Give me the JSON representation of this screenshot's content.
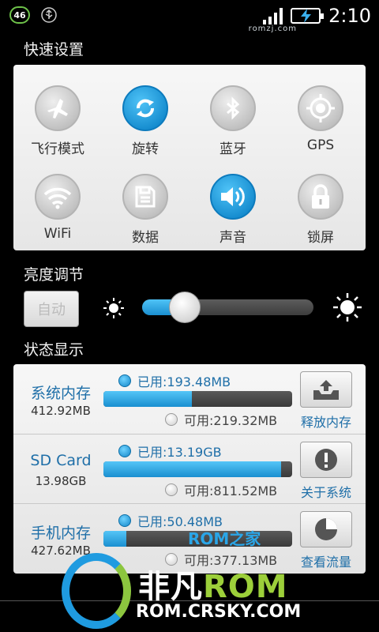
{
  "status_bar": {
    "network_badge": "46",
    "usb_icon": "usb-icon",
    "time": "2:10",
    "watermark": "romzj.com"
  },
  "quick_settings": {
    "title": "快速设置",
    "tiles": [
      {
        "label": "飞行模式",
        "icon": "airplane-icon",
        "active": false
      },
      {
        "label": "旋转",
        "icon": "rotate-icon",
        "active": true
      },
      {
        "label": "蓝牙",
        "icon": "bluetooth-icon",
        "active": false
      },
      {
        "label": "GPS",
        "icon": "gps-icon",
        "active": false
      },
      {
        "label": "WiFi",
        "icon": "wifi-icon",
        "active": false
      },
      {
        "label": "数据",
        "icon": "data-icon",
        "active": false
      },
      {
        "label": "声音",
        "icon": "sound-icon",
        "active": true
      },
      {
        "label": "锁屏",
        "icon": "lock-icon",
        "active": false
      }
    ]
  },
  "brightness": {
    "title": "亮度调节",
    "auto_label": "自动",
    "level": 0.15
  },
  "status_display": {
    "title": "状态显示",
    "rows": [
      {
        "name": "系统内存",
        "total": "412.92MB",
        "used": "已用:193.48MB",
        "available": "可用:219.32MB",
        "used_fraction": 0.47,
        "button_label": "释放内存",
        "button_icon": "tray-upload-icon"
      },
      {
        "name": "SD Card",
        "total": "13.98GB",
        "used": "已用:13.19GB",
        "available": "可用:811.52MB",
        "used_fraction": 0.94,
        "button_label": "关于系统",
        "button_icon": "info-icon"
      },
      {
        "name": "手机内存",
        "total": "427.62MB",
        "used": "已用:50.48MB",
        "available": "可用:377.13MB",
        "used_fraction": 0.12,
        "button_label": "查看流量",
        "button_icon": "pie-chart-icon"
      }
    ]
  },
  "branding": {
    "overlay_logo": "ROM之家",
    "main_prefix": "非凡",
    "main_suffix": "ROM",
    "url": "ROM.CRSKY.COM"
  },
  "colors": {
    "accent": "#1a8fd0",
    "label_blue": "#1f6fa8",
    "brand_green": "#9ccf3a"
  }
}
